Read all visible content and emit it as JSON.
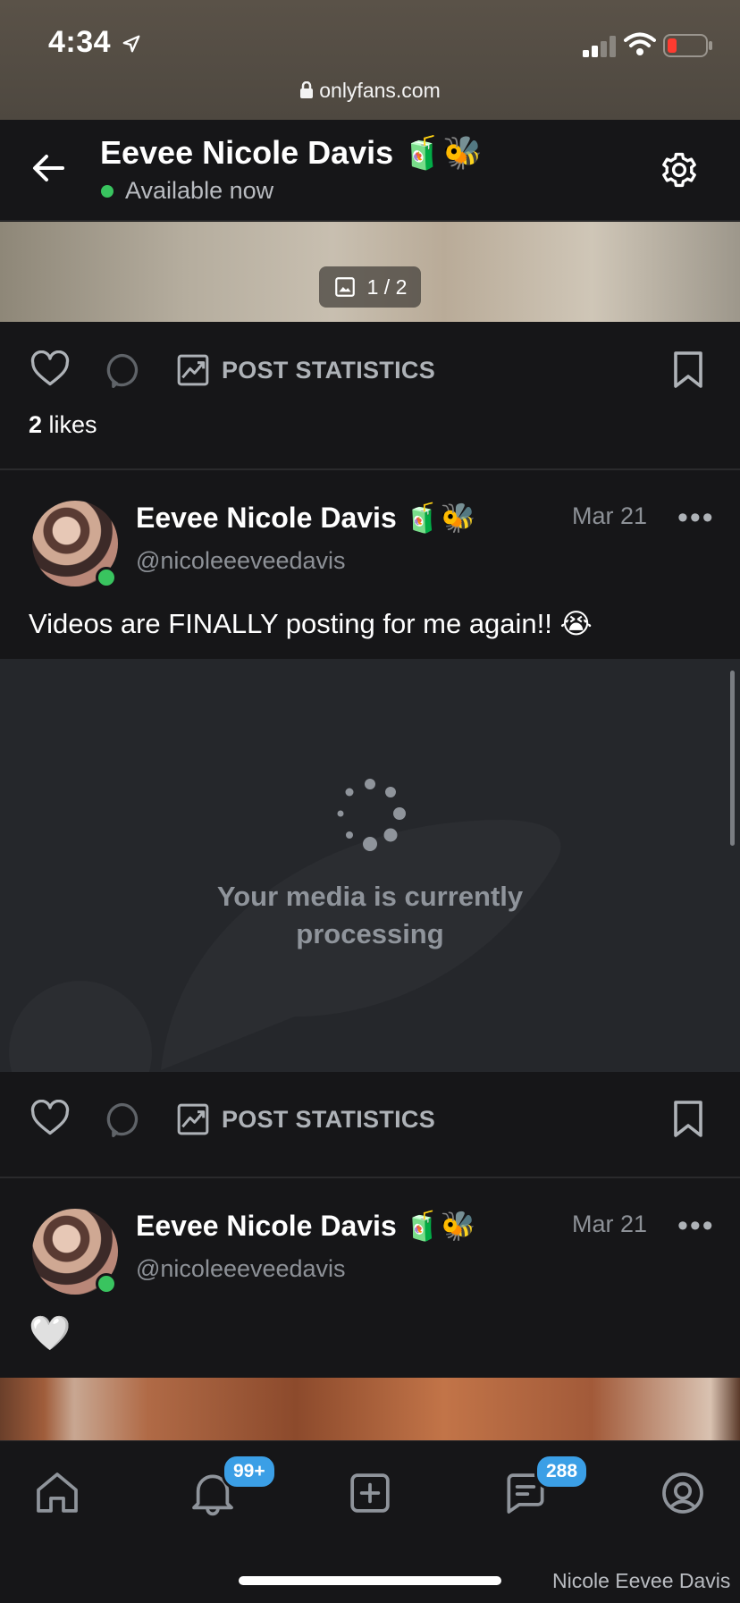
{
  "status_bar": {
    "time": "4:34",
    "url": "onlyfans.com"
  },
  "profile_header": {
    "name": "Eevee Nicole Davis 🧃🐝",
    "status": "Available now"
  },
  "media_counter": "1 / 2",
  "post_actions": {
    "statistics_label": "POST STATISTICS"
  },
  "first_post": {
    "likes_count": "2",
    "likes_label": "likes"
  },
  "posts": [
    {
      "author": "Eevee Nicole Davis 🧃🐝",
      "handle": "@nicoleeeveedavis",
      "date": "Mar 21",
      "more": "•••",
      "text": "Videos are FINALLY posting for me again!! 😭",
      "processing_text_line1": "Your media is currently",
      "processing_text_line2": "processing"
    },
    {
      "author": "Eevee Nicole Davis 🧃🐝",
      "handle": "@nicoleeeveedavis",
      "date": "Mar 21",
      "more": "•••",
      "text": "🤍"
    }
  ],
  "bottom_nav": {
    "items": [
      "home-icon",
      "bell-icon",
      "add-icon",
      "messages-icon",
      "profile-icon"
    ],
    "notifications_badge": "99+",
    "messages_badge": "288"
  },
  "watermark": "Nicole Eevee Davis",
  "colors": {
    "accent": "#3b9fe6",
    "online": "#39c45f",
    "background": "#161618"
  }
}
